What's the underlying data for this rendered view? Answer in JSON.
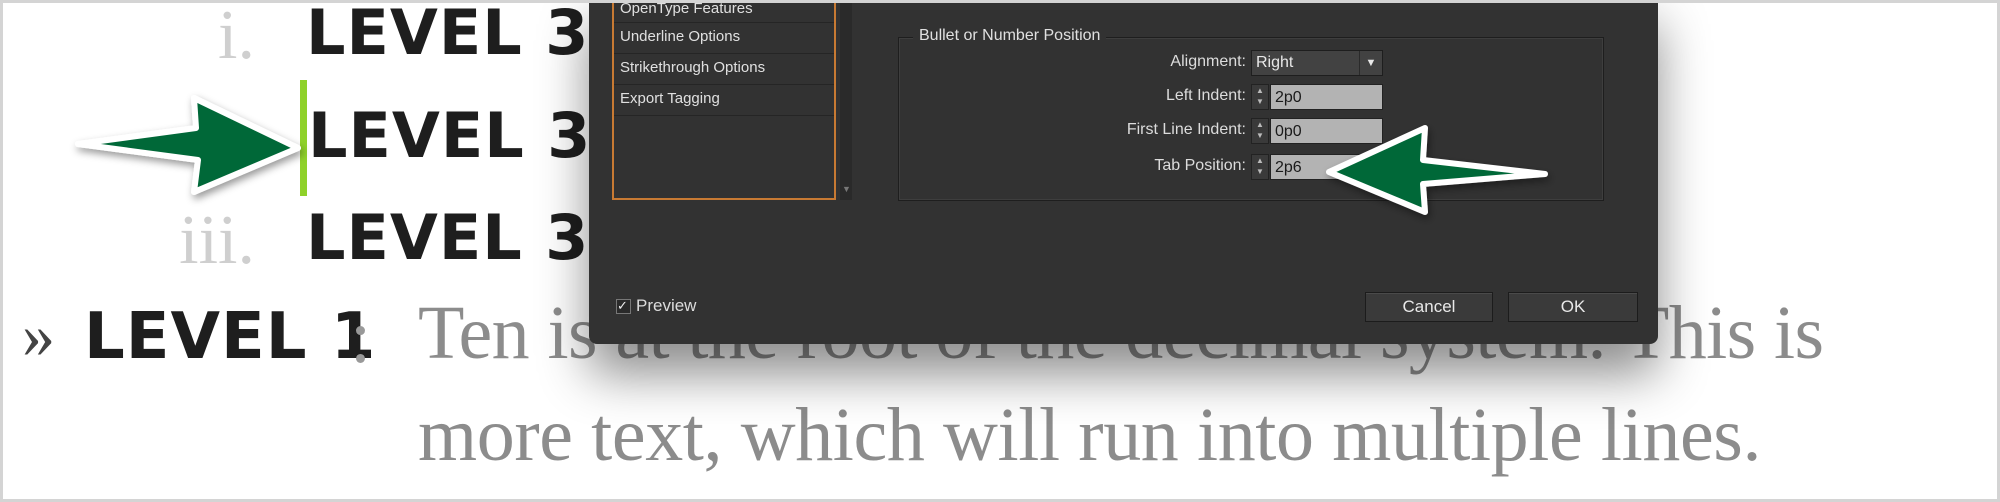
{
  "document": {
    "list_rows": [
      {
        "marker": "i.",
        "label": "LEVEL 3"
      },
      {
        "marker": "",
        "label": "LEVEL 3"
      },
      {
        "marker": "iii.",
        "label": "LEVEL 3"
      }
    ],
    "level1": {
      "marker": "»",
      "label": "LEVEL 1",
      "separator": ":"
    },
    "body_line1": "Ten is at the root of the decimal system. This is",
    "body_line2": "more text, which will run into multiple lines.",
    "cursor_color": "#8fd12a"
  },
  "dialog": {
    "sidebar_items": [
      "OpenType Features",
      "Underline Options",
      "Strikethrough Options",
      "Export Tagging"
    ],
    "group_title": "Bullet or Number Position",
    "alignment": {
      "label": "Alignment:",
      "value": "Right"
    },
    "left_indent": {
      "label": "Left Indent:",
      "value": "2p0"
    },
    "first_line_indent": {
      "label": "First Line Indent:",
      "value": "0p0"
    },
    "tab_position": {
      "label": "Tab Position:",
      "value": "2p6"
    },
    "preview": {
      "label": "Preview",
      "checked": true
    },
    "cancel_label": "Cancel",
    "ok_label": "OK",
    "accent_color": "#c87a33"
  },
  "annotations": {
    "arrow_color": "#006838"
  }
}
